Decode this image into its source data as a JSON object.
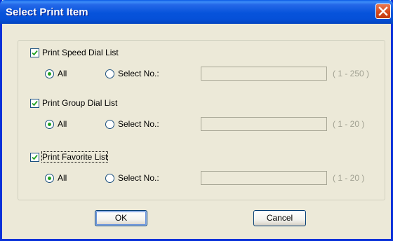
{
  "window": {
    "title": "Select Print Item",
    "close_icon": "close-icon"
  },
  "sections": [
    {
      "checkbox_label": "Print Speed Dial List",
      "checked": true,
      "radio_all_label": "All",
      "radio_select_label": "Select No.:",
      "selected": "All",
      "input_value": "",
      "range": "( 1 - 250 )"
    },
    {
      "checkbox_label": "Print Group Dial List",
      "checked": true,
      "radio_all_label": "All",
      "radio_select_label": "Select No.:",
      "selected": "All",
      "input_value": "",
      "range": "( 1 - 20 )"
    },
    {
      "checkbox_label": "Print Favorite List",
      "checked": true,
      "radio_all_label": "All",
      "radio_select_label": "Select No.:",
      "selected": "All",
      "input_value": "",
      "range": "( 1 - 20 )"
    }
  ],
  "buttons": {
    "ok_label": "OK",
    "cancel_label": "Cancel"
  },
  "colors": {
    "titlebar": "#0653db",
    "radio_selected": "#21a121",
    "check_mark": "#21a121",
    "close_button": "#d64a1d"
  }
}
